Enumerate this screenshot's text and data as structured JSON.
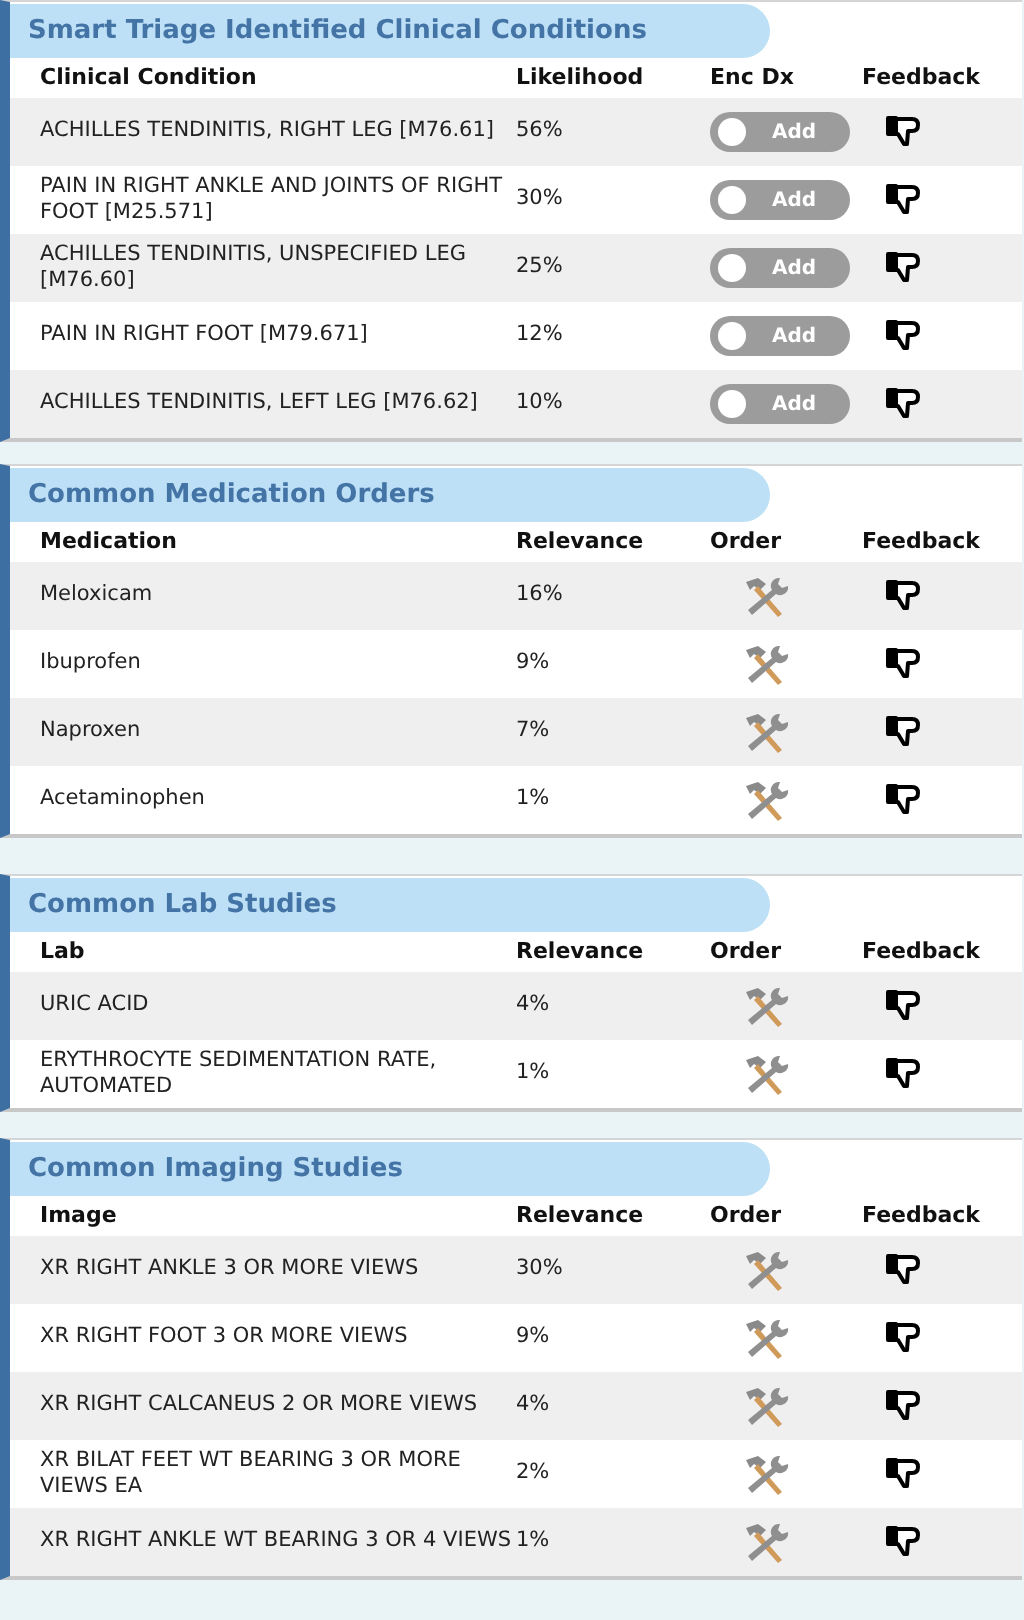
{
  "sections": [
    {
      "title": "Smart Triage Identified Clinical Conditions",
      "columns": [
        "Clinical Condition",
        "Likelihood",
        "Enc Dx",
        "Feedback"
      ],
      "rows": [
        {
          "name": "ACHILLES TENDINITIS, RIGHT LEG [M76.61]",
          "score": "56%",
          "action": {
            "kind": "toggle",
            "label": "Add",
            "on": false
          }
        },
        {
          "name": "PAIN IN RIGHT ANKLE AND JOINTS OF RIGHT FOOT [M25.571]",
          "score": "30%",
          "action": {
            "kind": "toggle",
            "label": "Add",
            "on": false
          }
        },
        {
          "name": "ACHILLES TENDINITIS, UNSPECIFIED LEG [M76.60]",
          "score": "25%",
          "action": {
            "kind": "toggle",
            "label": "Add",
            "on": false
          }
        },
        {
          "name": "PAIN IN RIGHT FOOT [M79.671]",
          "score": "12%",
          "action": {
            "kind": "toggle",
            "label": "Add",
            "on": false
          }
        },
        {
          "name": "ACHILLES TENDINITIS, LEFT LEG [M76.62]",
          "score": "10%",
          "action": {
            "kind": "toggle",
            "label": "Add",
            "on": false
          }
        }
      ]
    },
    {
      "title": "Common Medication Orders",
      "columns": [
        "Medication",
        "Relevance",
        "Order",
        "Feedback"
      ],
      "rows": [
        {
          "name": "Meloxicam",
          "score": "16%",
          "action": {
            "kind": "order"
          }
        },
        {
          "name": "Ibuprofen",
          "score": "9%",
          "action": {
            "kind": "order"
          }
        },
        {
          "name": "Naproxen",
          "score": "7%",
          "action": {
            "kind": "order"
          }
        },
        {
          "name": "Acetaminophen",
          "score": "1%",
          "action": {
            "kind": "order"
          }
        }
      ]
    },
    {
      "title": "Common Lab Studies",
      "columns": [
        "Lab",
        "Relevance",
        "Order",
        "Feedback"
      ],
      "rows": [
        {
          "name": "URIC ACID",
          "score": "4%",
          "action": {
            "kind": "order"
          }
        },
        {
          "name": "ERYTHROCYTE SEDIMENTATION RATE, AUTOMATED",
          "score": "1%",
          "action": {
            "kind": "order"
          }
        }
      ]
    },
    {
      "title": "Common Imaging Studies",
      "columns": [
        "Image",
        "Relevance",
        "Order",
        "Feedback"
      ],
      "rows": [
        {
          "name": "XR RIGHT ANKLE 3 OR MORE VIEWS",
          "score": "30%",
          "action": {
            "kind": "order"
          }
        },
        {
          "name": "XR RIGHT FOOT 3 OR MORE VIEWS",
          "score": "9%",
          "action": {
            "kind": "order"
          }
        },
        {
          "name": "XR RIGHT CALCANEUS 2 OR MORE VIEWS",
          "score": "4%",
          "action": {
            "kind": "order"
          }
        },
        {
          "name": "XR BILAT FEET WT BEARING 3 OR MORE VIEWS EA",
          "score": "2%",
          "action": {
            "kind": "order"
          }
        },
        {
          "name": "XR RIGHT ANKLE WT BEARING 3 OR 4 VIEWS",
          "score": "1%",
          "action": {
            "kind": "order"
          }
        }
      ]
    }
  ]
}
